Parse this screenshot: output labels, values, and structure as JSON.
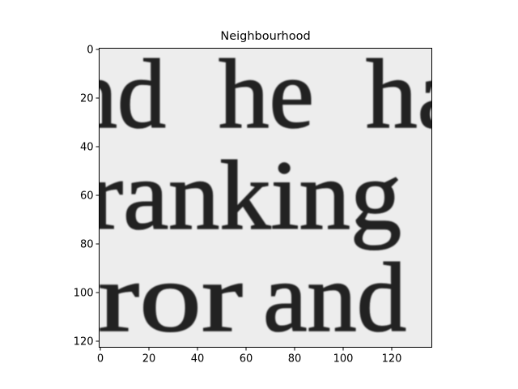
{
  "chart_data": {
    "type": "heatmap",
    "title": "Neighbourhood",
    "xlabel": "",
    "ylabel": "",
    "image_shape": [
      123,
      137
    ],
    "colormap": "gray",
    "xlim": [
      -0.5,
      136.5
    ],
    "ylim": [
      122.5,
      -0.5
    ],
    "x_ticks": [
      0,
      20,
      40,
      60,
      80,
      100,
      120
    ],
    "y_ticks": [
      0,
      20,
      40,
      60,
      80,
      100,
      120
    ],
    "x_tick_labels": [
      "0",
      "20",
      "40",
      "60",
      "80",
      "100",
      "120"
    ],
    "y_tick_labels": [
      "0",
      "20",
      "40",
      "60",
      "80",
      "100",
      "120"
    ],
    "image_text_lines": [
      {
        "words": [
          "nd",
          "he",
          "ha"
        ]
      },
      {
        "words": [
          "ranking"
        ]
      },
      {
        "words": [
          "rror",
          "and"
        ]
      }
    ],
    "colors": {
      "paper": "#ededed",
      "ink": "#222222"
    }
  }
}
